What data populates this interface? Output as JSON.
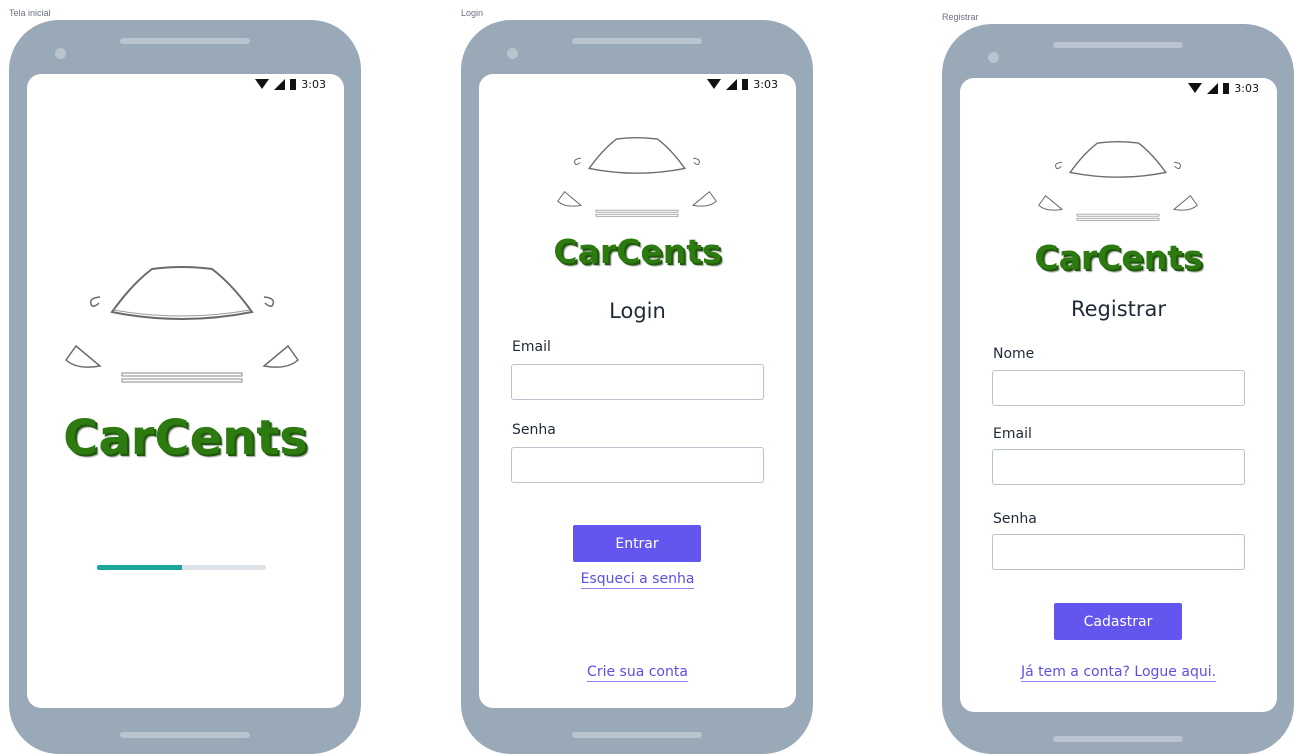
{
  "frames": [
    {
      "label": "Tela inicial"
    },
    {
      "label": "Login"
    },
    {
      "label": "Registrar"
    }
  ],
  "status_bar": {
    "time": "3:03"
  },
  "brand": {
    "name": "CarCents",
    "color": "#2c7a10"
  },
  "splash": {
    "progress": 0.5,
    "progress_color": "#1aa79a"
  },
  "login": {
    "title": "Login",
    "email_label": "Email",
    "email_value": "",
    "password_label": "Senha",
    "password_value": "",
    "submit_label": "Entrar",
    "forgot_link": "Esqueci a senha",
    "create_account_link": "Crie sua conta"
  },
  "register": {
    "title": "Registrar",
    "name_label": "Nome",
    "name_value": "",
    "email_label": "Email",
    "email_value": "",
    "password_label": "Senha",
    "password_value": "",
    "submit_label": "Cadastrar",
    "login_link": "Já tem a conta? Logue aqui."
  },
  "colors": {
    "accent": "#6356ee",
    "link": "#5b50e6",
    "phone_body": "#9aa9b8"
  }
}
